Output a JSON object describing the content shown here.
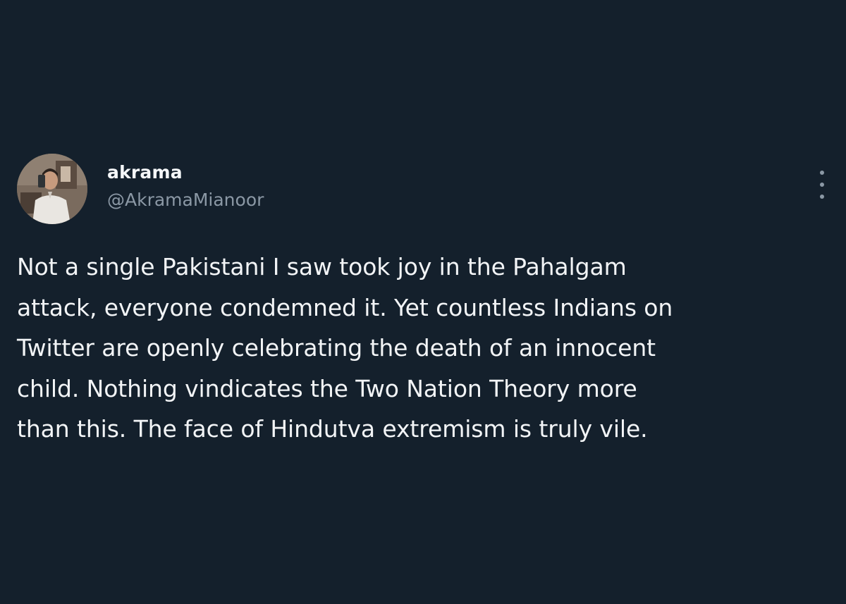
{
  "tweet": {
    "author": {
      "display_name": "akrama",
      "handle": "@AkramaMianoor",
      "avatar_icon": "user-photo-avatar"
    },
    "more_icon": "more-vertical-icon",
    "text_lines": [
      "Not a single Pakistani I saw took joy in the Pahalgam",
      "attack, everyone condemned it. Yet countless Indians on",
      "Twitter are openly celebrating the death of an innocent",
      "child. Nothing vindicates the Two Nation Theory more",
      "than this. The face of Hindutva extremism is truly vile."
    ]
  },
  "colors": {
    "background": "#14202c",
    "text_primary": "#f2f4f6",
    "text_secondary": "#8b98a5"
  }
}
